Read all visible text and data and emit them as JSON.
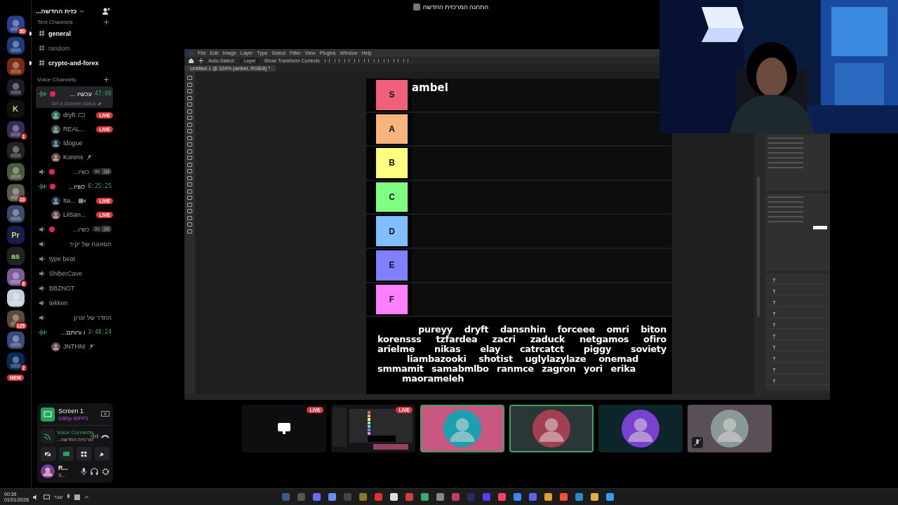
{
  "servers": [
    {
      "kind": "picture",
      "badge": "50"
    },
    {
      "kind": "picture"
    },
    {
      "kind": "picture"
    },
    {
      "kind": "picture"
    },
    {
      "kind": "label",
      "label": "K"
    },
    {
      "kind": "picture",
      "badge": "1"
    },
    {
      "kind": "picture"
    },
    {
      "kind": "picture"
    },
    {
      "kind": "picture",
      "badge": "10"
    },
    {
      "kind": "picture"
    },
    {
      "kind": "label",
      "label": "Pr"
    },
    {
      "kind": "label",
      "label": "as"
    },
    {
      "kind": "picture",
      "badge": "8"
    },
    {
      "kind": "picture"
    },
    {
      "kind": "picture",
      "badge": "125"
    },
    {
      "kind": "picture"
    },
    {
      "kind": "picture",
      "badge": "2"
    }
  ],
  "new_badge": "NEW",
  "server_header": {
    "name": "כזית החדשה..."
  },
  "text_category": "Text Channels",
  "text_channels": [
    {
      "name": "general",
      "unread": true
    },
    {
      "name": "random",
      "unread": false
    },
    {
      "name": "crypto-and-forex",
      "unread": true
    }
  ],
  "voice_category": "Voice Channels",
  "voice_channels": [
    {
      "name": "עכשיו ...",
      "dot": true,
      "active": true,
      "selected": true,
      "timer": "47:08",
      "status": "Set a channel status",
      "members": [
        {
          "name": "dryft",
          "badge": "LIVE",
          "streaming": true
        },
        {
          "name": "REAL...",
          "badge": "LIVE"
        },
        {
          "name": "Idogue"
        },
        {
          "name": "Korens",
          "muted": true
        }
      ]
    },
    {
      "name": "כשיו...",
      "dot": true,
      "active": false,
      "selected": false,
      "counter": [
        "00",
        "04"
      ]
    },
    {
      "name": "כשיו...",
      "dot": true,
      "active": true,
      "selected": false,
      "timer": "6:25:25",
      "members": [
        {
          "name": "Ita...",
          "badge": "LIVE",
          "camera": true
        },
        {
          "name": "LilSan...",
          "badge": "LIVE"
        }
      ]
    },
    {
      "name": "כשיו...",
      "dot": true,
      "active": false,
      "selected": false,
      "counter": [
        "00",
        "04"
      ]
    },
    {
      "name": "הסאונה של יקיר",
      "dot": false,
      "active": false,
      "selected": false
    },
    {
      "name": "type beat",
      "dot": false,
      "active": false,
      "selected": false
    },
    {
      "name": "ShiberCave",
      "dot": false,
      "active": false,
      "selected": false
    },
    {
      "name": "BBZNOT",
      "dot": false,
      "active": false,
      "selected": false
    },
    {
      "name": "tekken",
      "dot": false,
      "active": false,
      "selected": false
    },
    {
      "name": "החדר של זגרון",
      "dot": false,
      "active": false,
      "selected": false
    },
    {
      "name": "ו ורותם...",
      "dot": false,
      "active": true,
      "selected": false,
      "timer": "3:48:24",
      "members": [
        {
          "name": "JNTHN!",
          "muted": true
        }
      ]
    }
  ],
  "stream_panel": {
    "title": "Screen 1",
    "quality": "1080p 60FPS"
  },
  "voice_panel": {
    "status": "Voice Connecte",
    "server": "מרכזית החדשה..."
  },
  "user_panel": {
    "name": "R...",
    "status": "S..."
  },
  "stage_title": "התחנה המרכזית החדשה",
  "photoshop": {
    "menu": [
      "File",
      "Edit",
      "Image",
      "Layer",
      "Type",
      "Select",
      "Filter",
      "View",
      "Plugins",
      "Window",
      "Help"
    ],
    "options": [
      "Auto-Select:",
      "Layer",
      "Show Transform Controls"
    ],
    "doc_tab": "Untitled-1 @ 104% (ambel, RGB/8) *",
    "tiers": [
      {
        "label": "S",
        "color": "#f0607a",
        "items": [
          "ambel"
        ]
      },
      {
        "label": "A",
        "color": "#f7b47c"
      },
      {
        "label": "B",
        "color": "#ffff7f"
      },
      {
        "label": "C",
        "color": "#80ff80"
      },
      {
        "label": "D",
        "color": "#80bfff"
      },
      {
        "label": "E",
        "color": "#7f7fff"
      },
      {
        "label": "F",
        "color": "#ff7fff"
      }
    ],
    "pool": [
      [
        "pureyy",
        "dryft",
        "dansnhin",
        "forceee",
        "omri",
        "biton"
      ],
      [
        "korensss",
        "tzfardea",
        "zacri",
        "zaduck",
        "netgamos",
        "ofiro"
      ],
      [
        "arielme",
        "nikas",
        "elay",
        "catrcatct",
        "piggy",
        "soviety"
      ],
      [
        "liambazooki",
        "shotist",
        "uglylazylaze",
        "onemad"
      ],
      [
        "smmamit",
        "samabmlbo",
        "ranmce",
        "zagron",
        "yori",
        "erika"
      ],
      [
        "maorameleh"
      ]
    ]
  },
  "tiles": [
    {
      "kind": "screen",
      "badge": "LIVE"
    },
    {
      "kind": "preview",
      "badge": "LIVE"
    },
    {
      "kind": "avatar",
      "color": "#c9577f",
      "speaking": true,
      "muted": false
    },
    {
      "kind": "avatar",
      "color": "#2b3636",
      "speaking": true,
      "muted": false
    },
    {
      "kind": "avatar",
      "color": "#0c252b",
      "speaking": false,
      "muted": false
    },
    {
      "kind": "avatar",
      "color": "#5a4f56",
      "speaking": false,
      "muted": true
    }
  ],
  "taskbar": {
    "time": "00:39",
    "date": "01/01/2026",
    "language": "עבר"
  }
}
